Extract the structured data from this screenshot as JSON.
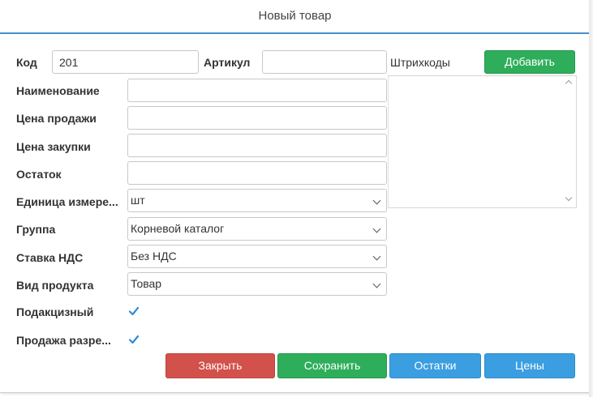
{
  "dialog": {
    "title": "Новый товар"
  },
  "fields": {
    "code": {
      "label": "Код",
      "value": "201"
    },
    "article": {
      "label": "Артикул",
      "value": ""
    },
    "barcodes": {
      "label": "Штрихкоды",
      "add_label": "Добавить"
    },
    "name": {
      "label": "Наименование",
      "value": ""
    },
    "sale_price": {
      "label": "Цена продажи",
      "value": ""
    },
    "purchase_price": {
      "label": "Цена закупки",
      "value": ""
    },
    "stock": {
      "label": "Остаток",
      "value": ""
    },
    "unit": {
      "label": "Единица измере...",
      "value": "шт"
    },
    "group": {
      "label": "Группа",
      "value": "Корневой каталог"
    },
    "vat_rate": {
      "label": "Ставка НДС",
      "value": "Без НДС"
    },
    "product_type": {
      "label": "Вид продукта",
      "value": "Товар"
    },
    "excise": {
      "label": "Подакцизный",
      "checked": true
    },
    "sale_allowed": {
      "label": "Продажа разре...",
      "checked": true
    }
  },
  "buttons": {
    "close": "Закрыть",
    "save": "Сохранить",
    "stock": "Остатки",
    "prices": "Цены"
  },
  "colors": {
    "accent": "#4a8ec9",
    "green": "#2eae5a",
    "red": "#d2514a",
    "blue": "#3a9ee0",
    "checkbox": "#2f8bd6"
  }
}
